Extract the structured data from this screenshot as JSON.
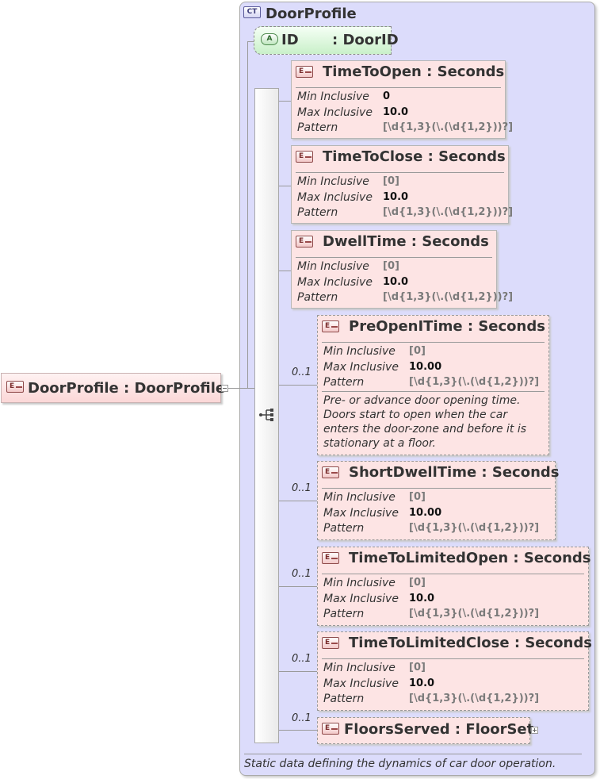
{
  "root": {
    "badge": "E",
    "label": "DoorProfile : DoorProfile"
  },
  "complex_type": {
    "badge": "CT",
    "name": "DoorProfile",
    "documentation": "Static data defining the dynamics of car door operation."
  },
  "attribute": {
    "badge": "A",
    "name": "ID",
    "type": ": DoorID"
  },
  "facet_labels": {
    "min": "Min Inclusive",
    "max": "Max Inclusive",
    "pattern": "Pattern"
  },
  "elements": [
    {
      "name": "TimeToOpen : Seconds",
      "occurrence": "",
      "min": "0",
      "max": "10.0",
      "pattern": "[\\d{1,3}(\\.(\\d{1,2}))?]"
    },
    {
      "name": "TimeToClose : Seconds",
      "occurrence": "",
      "min": "[0]",
      "max": "10.0",
      "pattern": "[\\d{1,3}(\\.(\\d{1,2}))?]"
    },
    {
      "name": "DwellTime : Seconds",
      "occurrence": "",
      "min": "[0]",
      "max": "10.0",
      "pattern": "[\\d{1,3}(\\.(\\d{1,2}))?]"
    },
    {
      "name": "PreOpenITime : Seconds",
      "occurrence": "0..1",
      "min": "[0]",
      "max": "10.00",
      "pattern": "[\\d{1,3}(\\.(\\d{1,2}))?]",
      "doc": "Pre- or advance door opening time. Doors start to open when the car enters the door-zone and before it is stationary at a floor."
    },
    {
      "name": "ShortDwellTime : Seconds",
      "occurrence": "0..1",
      "min": "[0]",
      "max": "10.00",
      "pattern": "[\\d{1,3}(\\.(\\d{1,2}))?]"
    },
    {
      "name": "TimeToLimitedOpen : Seconds",
      "occurrence": "0..1",
      "min": "[0]",
      "max": "10.0",
      "pattern": "[\\d{1,3}(\\.(\\d{1,2}))?]"
    },
    {
      "name": "TimeToLimitedClose : Seconds",
      "occurrence": "0..1",
      "min": "[0]",
      "max": "10.0",
      "pattern": "[\\d{1,3}(\\.(\\d{1,2}))?]"
    },
    {
      "name": "FloorsServed : FloorSet",
      "occurrence": "0..1"
    }
  ]
}
